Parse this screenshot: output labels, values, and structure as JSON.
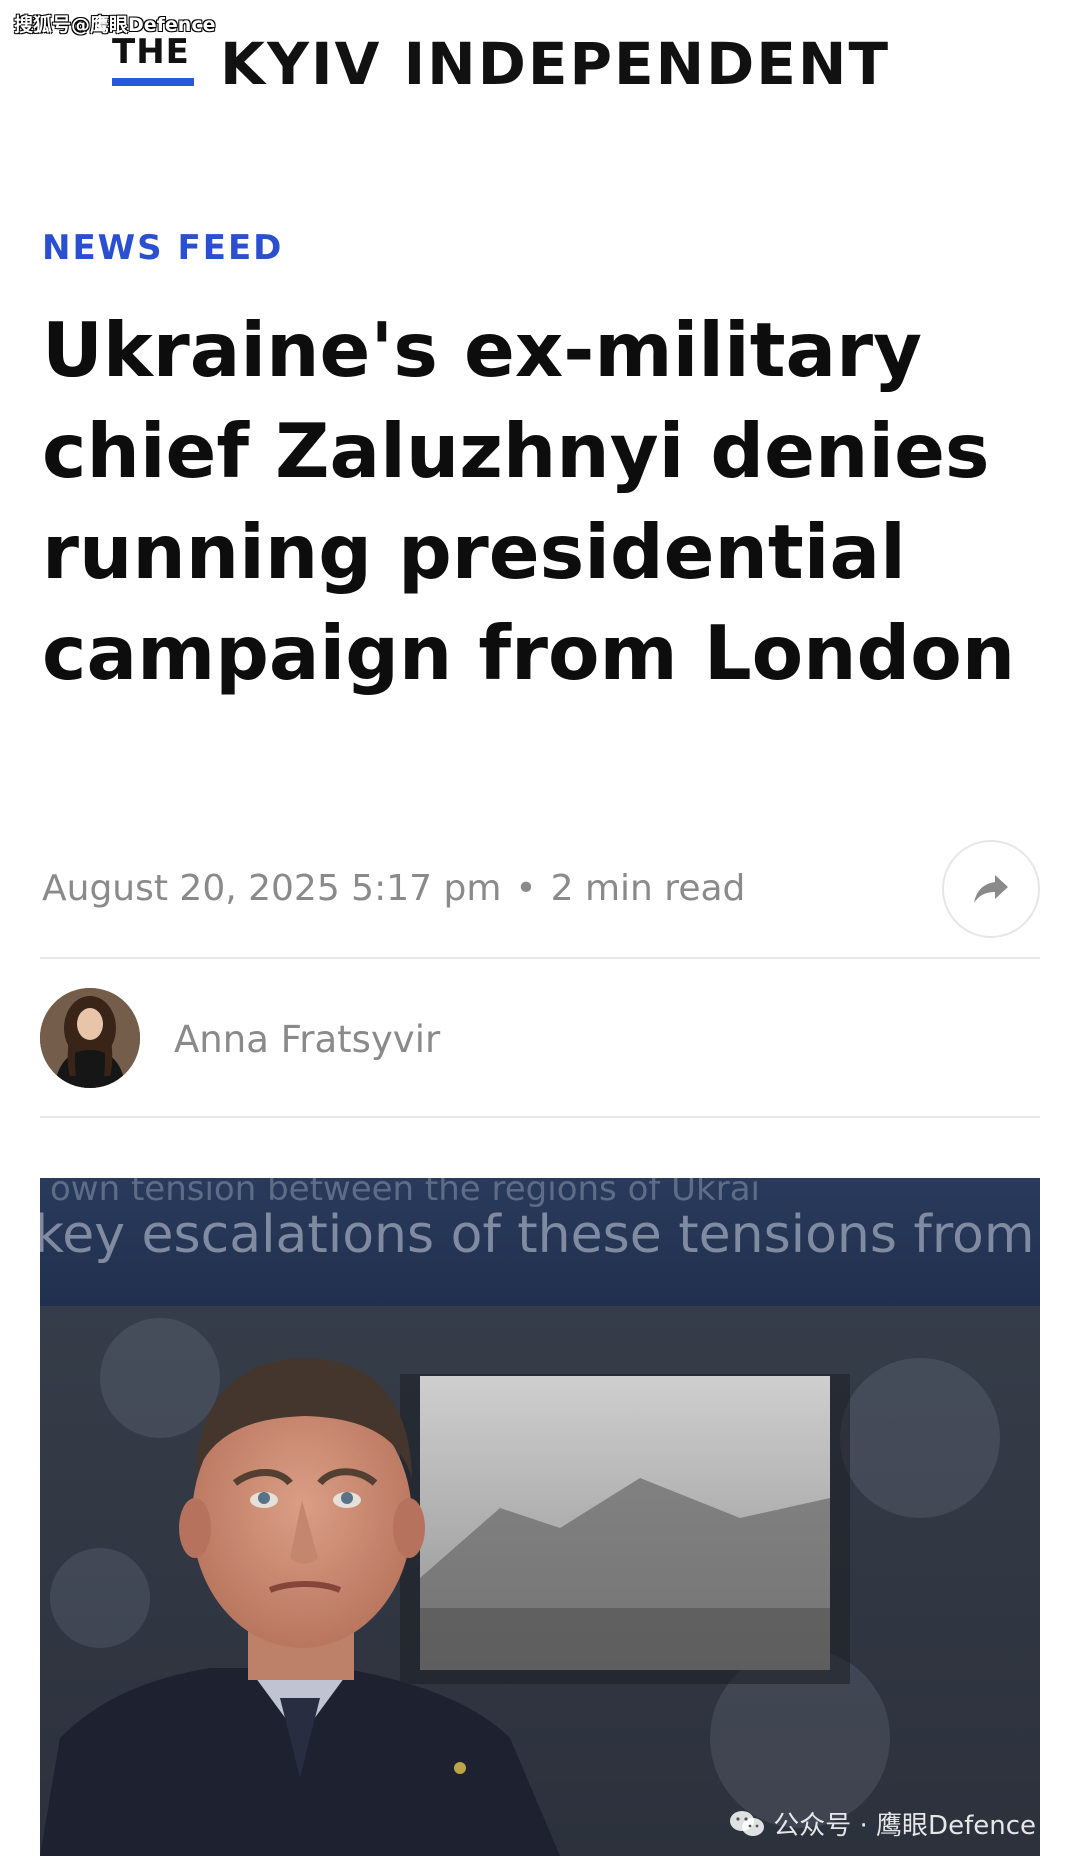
{
  "overlay": {
    "source_watermark": "搜狐号@鹰眼Defence",
    "bottom_watermark": "公众号 · 鹰眼Defence"
  },
  "header": {
    "logo_the": "THE",
    "logo_name": "KYIV INDEPENDENT"
  },
  "article": {
    "section_label": "NEWS FEED",
    "headline": "Ukraine's ex-military chief Zaluzhnyi denies running presidential campaign from London",
    "date": "August 20, 2025 5:17 pm",
    "separator": "•",
    "read_time": "2 min read",
    "author": "Anna Fratsyvir"
  },
  "hero": {
    "background_sign_line1": "own tension between the regions of Ukrai",
    "background_sign_line2": "key escalations of these tensions from th"
  },
  "colors": {
    "brand_blue": "#2a58d9",
    "section_blue": "#2a4fd0",
    "meta_gray": "#8a8a8a",
    "divider": "#e8e8e8"
  },
  "icons": {
    "share": "share-arrow-icon",
    "wechat": "wechat-icon"
  }
}
